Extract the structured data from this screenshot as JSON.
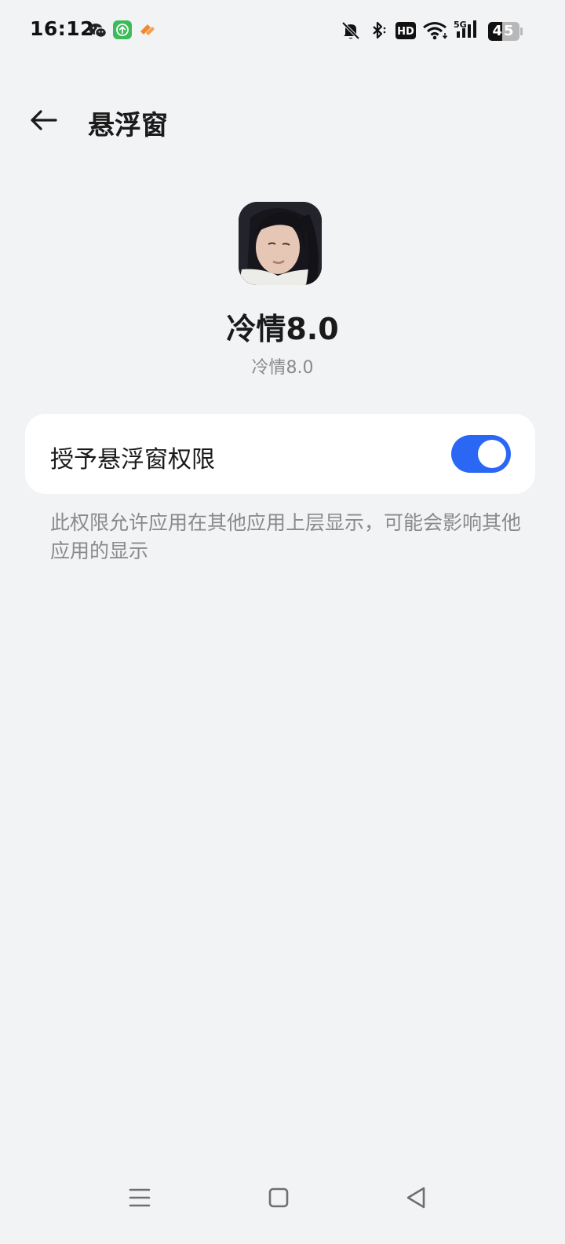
{
  "status_bar": {
    "time": "16:12",
    "network": "5G",
    "hd": "HD",
    "battery": "45",
    "icons": [
      "wechat-icon",
      "upload-app-icon",
      "orange-app-icon",
      "mute-bell-icon",
      "bluetooth-icon",
      "hd-icon",
      "wifi-icon",
      "signal-icon",
      "battery-icon"
    ]
  },
  "header": {
    "title": "悬浮窗",
    "back_icon": "back-arrow-icon"
  },
  "app": {
    "name": "冷情8.0",
    "subtitle": "冷情8.0"
  },
  "permission": {
    "label": "授予悬浮窗权限",
    "enabled": true,
    "description": "此权限允许应用在其他应用上层显示，可能会影响其他应用的显示"
  },
  "nav_bar": {
    "icons": [
      "menu-icon",
      "home-icon",
      "back-icon"
    ]
  },
  "colors": {
    "accent": "#2a67f5",
    "background": "#f2f3f5",
    "card": "#ffffff",
    "secondary_text": "#8a8a8a"
  }
}
